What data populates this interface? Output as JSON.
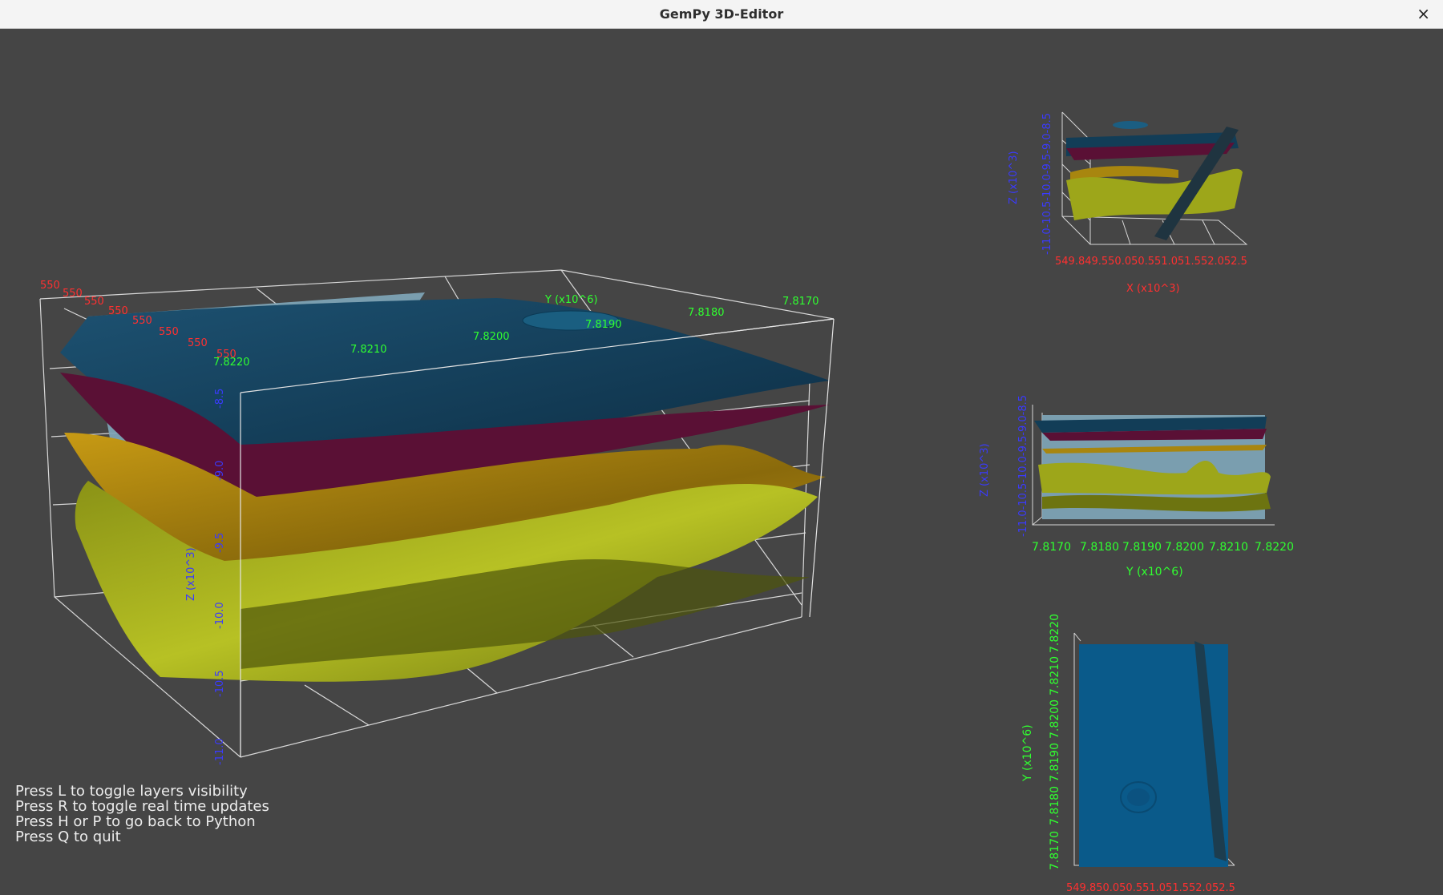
{
  "window": {
    "title": "GemPy 3D-Editor",
    "close_glyph": "×",
    "close_icon": "close-icon"
  },
  "main_view": {
    "x_ticks": [
      "550",
      "550",
      "550",
      "550",
      "550",
      "550",
      "550",
      "550"
    ],
    "y_ticks": [
      "7.8220",
      "7.8210",
      "7.8200",
      "7.8190",
      "7.8180",
      "7.8170"
    ],
    "y_axis_label": "Y (x10^6)",
    "z_ticks": [
      "-8.5",
      "-9.0",
      "-9.5",
      "-10.0",
      "-10.5",
      "-11.0"
    ],
    "z_axis_label": "Z (x10^3)"
  },
  "view_xz": {
    "x_ticks": "549.849.550.050.551.051.552.052.5",
    "x_axis_label": "X (x10^3)",
    "z_ticks": "-11.0-10.5-10.0-9.5-9.0-8.5",
    "z_axis_label": "Z (x10^3)"
  },
  "view_yz": {
    "y_ticks": [
      "7.8170",
      "7.8180",
      "7.8190",
      "7.8200",
      "7.8210",
      "7.8220"
    ],
    "y_axis_label": "Y (x10^6)",
    "z_ticks": "-11.0-10.5-10.0-9.5-9.0-8.5",
    "z_axis_label": "Z (x10^3)"
  },
  "view_xy": {
    "y_ticks": [
      "7.8170",
      "7.8180",
      "7.8190",
      "7.8200",
      "7.8210",
      "7.8220"
    ],
    "y_axis_label": "Y (x10^6)",
    "x_ticks": "549.850.050.551.051.552.052.5"
  },
  "help_lines": [
    "Press L to toggle layers visibility",
    "Press R to toggle real time updates",
    "Press H or P to go back to Python",
    "Press Q to quit"
  ],
  "colors": {
    "background": "#454545",
    "layer_top": "#123d57",
    "layer_second": "#5a1035",
    "layer_third": "#a8860f",
    "layer_fourth": "#9da61a",
    "fault_plane": "#7fa6b8",
    "x_axis": "#ff3030",
    "y_axis": "#30ff30",
    "z_axis": "#3030ff",
    "map_blue": "#0a5a8a"
  }
}
